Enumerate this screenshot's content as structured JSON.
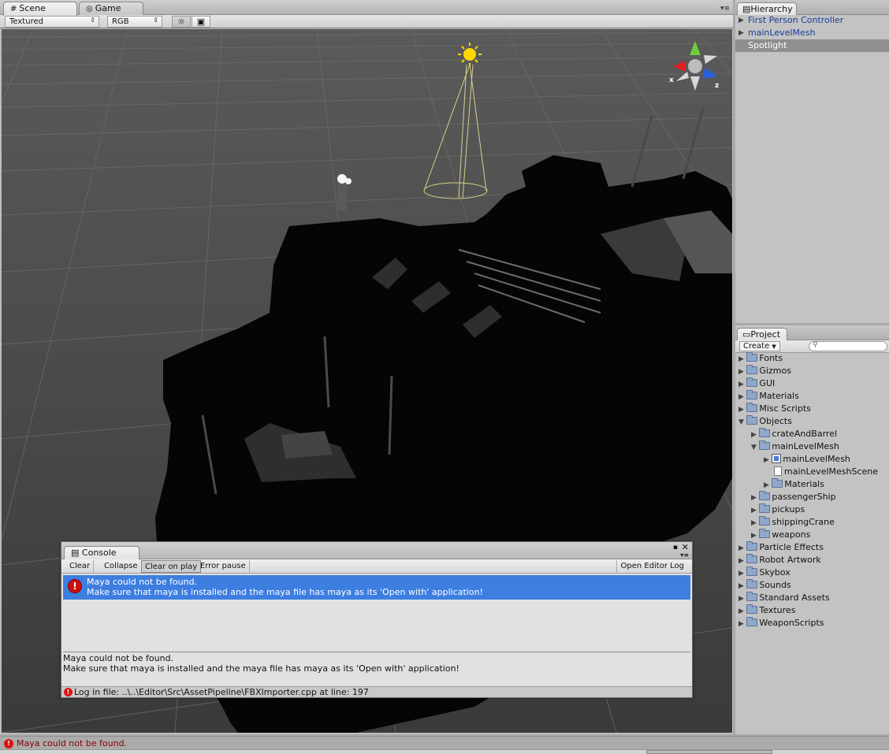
{
  "scene_window": {
    "tabs": [
      {
        "label": "Scene",
        "icon": "grid-icon"
      },
      {
        "label": "Game",
        "icon": "gamepad-icon"
      }
    ],
    "toolbar": {
      "render_mode": "Textured",
      "color_mode": "RGB",
      "lighting_icon": "sun-icon",
      "image_icon": "picture-icon"
    },
    "gizmo": {
      "x_label": "x",
      "z_label": "z"
    }
  },
  "hierarchy": {
    "title": "Hierarchy",
    "items": [
      {
        "label": "First Person Controller"
      },
      {
        "label": "mainLevelMesh"
      },
      {
        "label": "Spotlight"
      }
    ]
  },
  "project": {
    "title": "Project",
    "create_label": "Create",
    "search_placeholder": "",
    "tree": [
      {
        "label": "Fonts"
      },
      {
        "label": "Gizmos"
      },
      {
        "label": "GUI"
      },
      {
        "label": "Materials"
      },
      {
        "label": "Misc Scripts"
      },
      {
        "label": "Objects"
      },
      {
        "label": "crateAndBarrel"
      },
      {
        "label": "mainLevelMesh"
      },
      {
        "label": "mainLevelMesh"
      },
      {
        "label": "mainLevelMeshScene"
      },
      {
        "label": "Materials"
      },
      {
        "label": "passengerShip"
      },
      {
        "label": "pickups"
      },
      {
        "label": "shippingCrane"
      },
      {
        "label": "weapons"
      },
      {
        "label": "Particle Effects"
      },
      {
        "label": "Robot Artwork"
      },
      {
        "label": "Skybox"
      },
      {
        "label": "Sounds"
      },
      {
        "label": "Standard Assets"
      },
      {
        "label": "Textures"
      },
      {
        "label": "WeaponScripts"
      }
    ]
  },
  "console": {
    "title": "Console",
    "buttons": {
      "clear": "Clear",
      "collapse": "Collapse",
      "clear_on_play": "Clear on play",
      "error_pause": "Error pause",
      "open_editor_log": "Open Editor Log"
    },
    "message": {
      "line1": "Maya could not be found.",
      "line2": "Make sure that maya is installed and the maya file has maya as its 'Open with' application!"
    },
    "detail": {
      "line1": "Maya could not be found.",
      "line2": "Make sure that maya is installed and the maya file has maya as its 'Open with' application!"
    },
    "log_line": "Log in file: ..\\..\\Editor\\Src\\AssetPipeline\\FBXImporter.cpp at line: 197"
  },
  "status_bar": {
    "message": "Maya could not be found."
  },
  "colors": {
    "selection_blue": "#3d7ee0",
    "error_red": "#c11111",
    "prefab_blue": "#1a3d9c"
  }
}
